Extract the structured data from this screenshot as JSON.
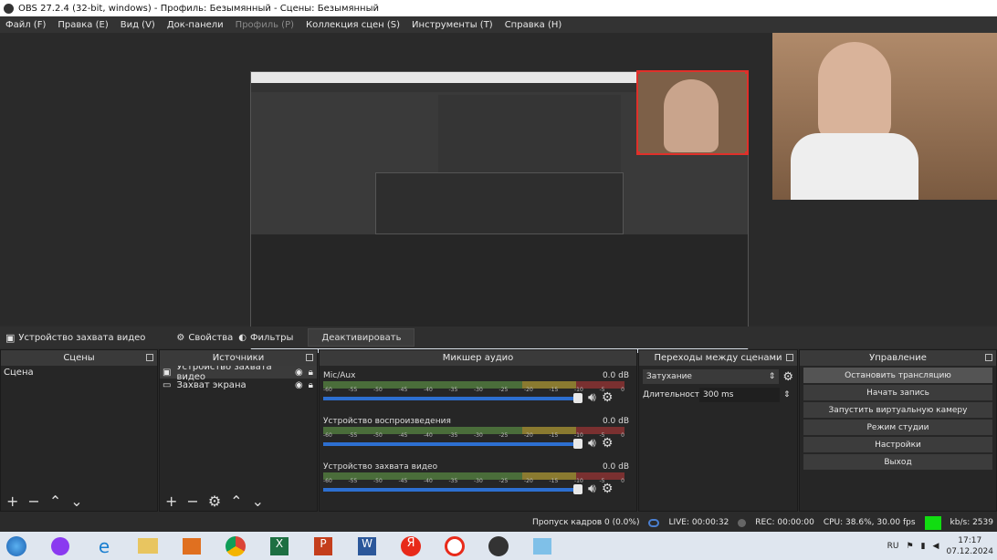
{
  "title": "OBS 27.2.4 (32-bit, windows) - Профиль: Безымянный - Сцены: Безымянный",
  "menu": [
    "Файл (F)",
    "Правка (E)",
    "Вид (V)",
    "Док-панели",
    "Профиль (P)",
    "Коллекция сцен (S)",
    "Инструменты (T)",
    "Справка (H)"
  ],
  "menu_disabled_index": 4,
  "toolbar": {
    "source_name": "Устройство захвата видео",
    "properties": "Свойства",
    "filters": "Фильтры",
    "deactivate": "Деактивировать"
  },
  "scenes": {
    "title": "Сцены",
    "items": [
      "Сцена"
    ]
  },
  "sources": {
    "title": "Источники",
    "items": [
      "Устройство захвата видео",
      "Захват экрана"
    ]
  },
  "mixer": {
    "title": "Микшер аудио",
    "scale": [
      "-60",
      "-55",
      "-50",
      "-45",
      "-40",
      "-35",
      "-30",
      "-25",
      "-20",
      "-15",
      "-10",
      "-5",
      "0"
    ],
    "channels": [
      {
        "name": "Mic/Aux",
        "db": "0.0 dB"
      },
      {
        "name": "Устройство воспроизведения",
        "db": "0.0 dB"
      },
      {
        "name": "Устройство захвата видео",
        "db": "0.0 dB"
      }
    ]
  },
  "transitions": {
    "title": "Переходы между сценами",
    "selected": "Затухание",
    "duration_label": "Длительность",
    "duration_value": "300 ms"
  },
  "controls": {
    "title": "Управление",
    "buttons": [
      "Остановить трансляцию",
      "Начать запись",
      "Запустить виртуальную камеру",
      "Режим студии",
      "Настройки",
      "Выход"
    ]
  },
  "status": {
    "dropped": "Пропуск кадров 0 (0.0%)",
    "live": "LIVE: 00:00:32",
    "rec": "REC: 00:00:00",
    "cpu": "CPU: 38.6%, 30.00 fps",
    "kbps": "kb/s: 2539"
  },
  "taskbar": {
    "lang": "RU",
    "time": "17:17",
    "date": "07.12.2024"
  },
  "colors": {
    "accent": "#2d6fd0",
    "selection": "#e0302a",
    "status_ok": "#11dd11"
  }
}
